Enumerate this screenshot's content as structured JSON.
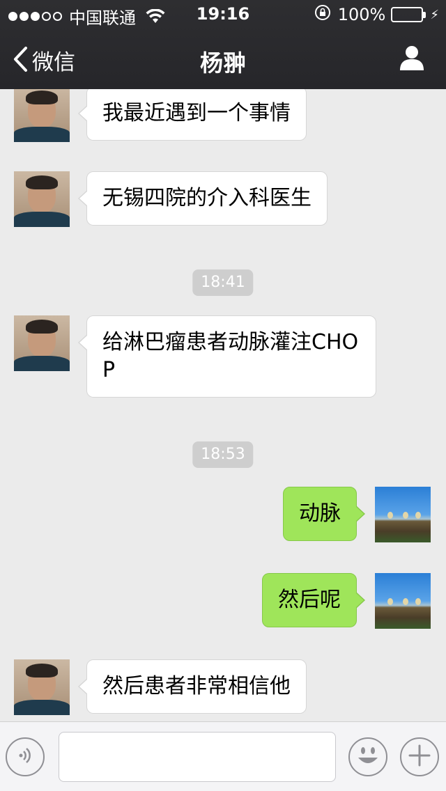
{
  "status_bar": {
    "carrier": "中国联通",
    "time": "19:16",
    "battery": "100%",
    "signal_bars_filled": 3,
    "signal_bars_total": 5
  },
  "nav": {
    "back_label": "微信",
    "title": "杨翀"
  },
  "messages": [
    {
      "side": "left",
      "text": "我最近遇到一个事情"
    },
    {
      "side": "left",
      "text": "无锡四院的介入科医生"
    },
    {
      "type": "time",
      "text": "18:41"
    },
    {
      "side": "left",
      "text": "给淋巴瘤患者动脉灌注CHOP"
    },
    {
      "type": "time",
      "text": "18:53"
    },
    {
      "side": "right",
      "text": "动脉"
    },
    {
      "side": "right",
      "text": "然后呢"
    },
    {
      "side": "left",
      "text": "然后患者非常相信他"
    }
  ],
  "input": {
    "placeholder": ""
  },
  "colors": {
    "header_bg": "#2b2b2e",
    "chat_bg": "#ebebeb",
    "outgoing_bubble": "#9fe55a",
    "incoming_bubble": "#ffffff",
    "battery_fill": "#4cd964"
  }
}
